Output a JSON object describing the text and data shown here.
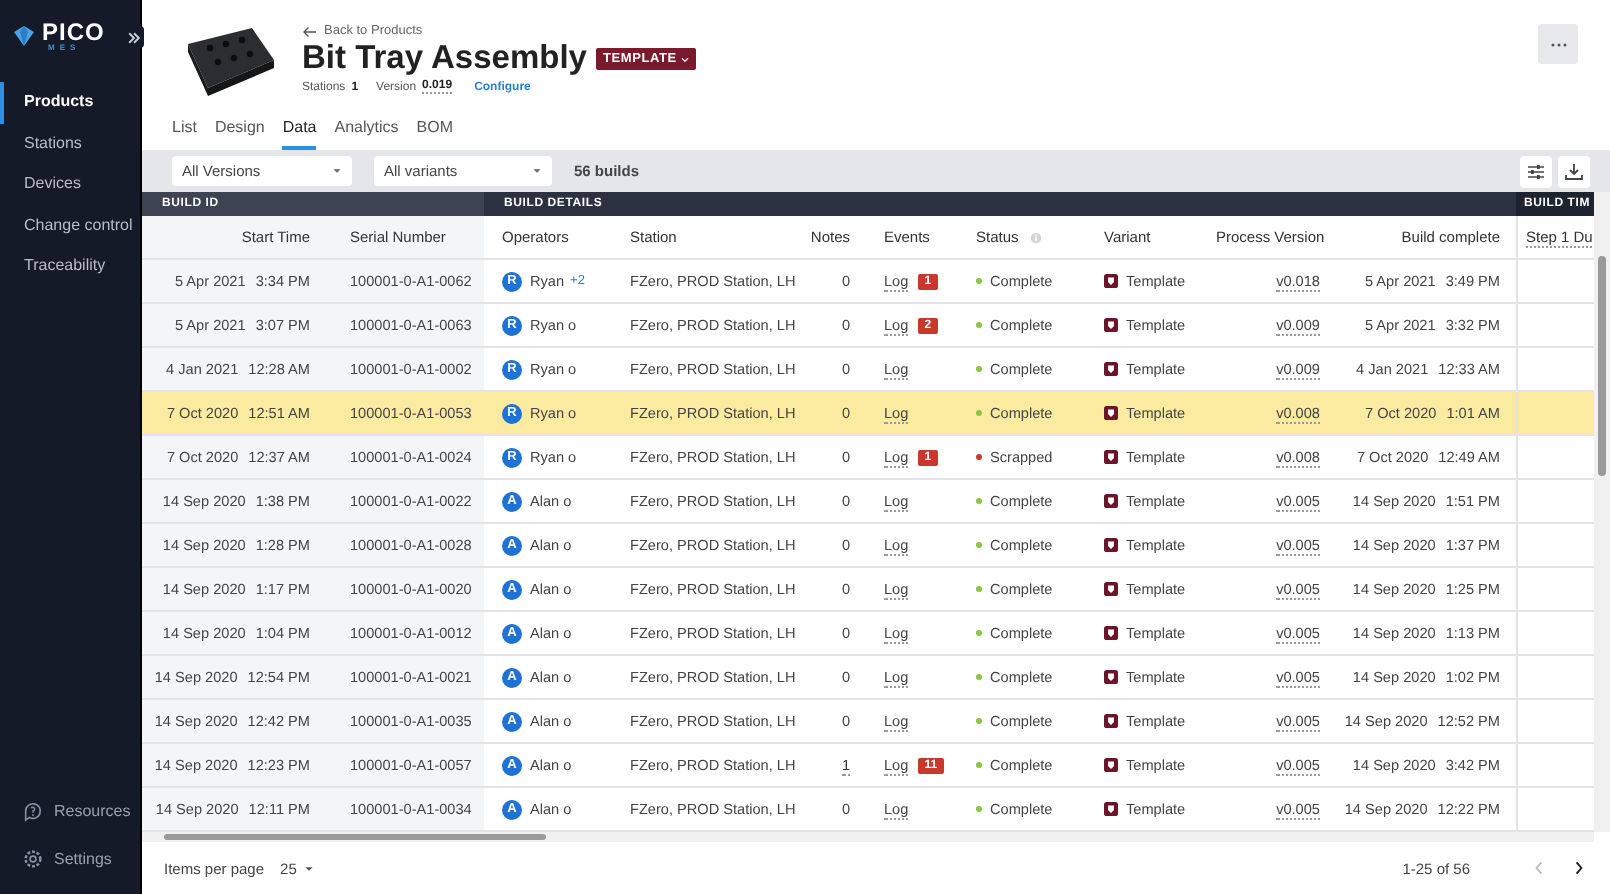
{
  "sidebar": {
    "logo": {
      "name": "PICO",
      "tagline": "MES"
    },
    "items": [
      {
        "label": "Products",
        "selected": true
      },
      {
        "label": "Stations",
        "selected": false
      },
      {
        "label": "Devices",
        "selected": false
      },
      {
        "label": "Change control",
        "selected": false
      },
      {
        "label": "Traceability",
        "selected": false
      }
    ],
    "footer_items": [
      {
        "label": "Resources",
        "kind": "help"
      },
      {
        "label": "Settings",
        "kind": "settings"
      }
    ]
  },
  "product": {
    "back_link": "Back to Products",
    "title": "Bit Tray Assembly",
    "badge": "TEMPLATE",
    "stations_label": "Stations",
    "stations_value": "1",
    "version_label": "Version",
    "version_value": "0.019",
    "configure_link": "Configure"
  },
  "tabs": [
    {
      "label": "List",
      "selected": false
    },
    {
      "label": "Design",
      "selected": false
    },
    {
      "label": "Data",
      "selected": true
    },
    {
      "label": "Analytics",
      "selected": false
    },
    {
      "label": "BOM",
      "selected": false
    }
  ],
  "filters": {
    "versions": "All Versions",
    "variants": "All variants",
    "count": "56 builds"
  },
  "table": {
    "groups": [
      {
        "label": "BUILD ID"
      },
      {
        "label": "BUILD DETAILS"
      },
      {
        "label": "BUILD TIM"
      }
    ],
    "columns": [
      {
        "label": "Start Time",
        "kind": "plain"
      },
      {
        "label": "Serial Number",
        "kind": "plain"
      },
      {
        "label": "Operators",
        "kind": "plain"
      },
      {
        "label": "Station",
        "kind": "plain"
      },
      {
        "label": "Notes",
        "kind": "plain"
      },
      {
        "label": "Events",
        "kind": "plain"
      },
      {
        "label": "Status",
        "kind": "info"
      },
      {
        "label": "Variant",
        "kind": "plain"
      },
      {
        "label": "Process Version",
        "kind": "plain"
      },
      {
        "label": "Build complete",
        "kind": "plain"
      },
      {
        "label": "Step 1 Du",
        "kind": "plain"
      }
    ],
    "rows": [
      {
        "selected": false,
        "start_date": "5 Apr 2021",
        "start_time": "3:34 PM",
        "serial": "100001-0-A1-0062",
        "initial": "R",
        "operator": "Ryan",
        "operator_extra": "+2",
        "station": "FZero, PROD Station, LH",
        "notes": "0",
        "notes_link": false,
        "events": "Log",
        "events_count": "1",
        "status": {
          "label": "Complete",
          "kind": "complete"
        },
        "variant": "Template",
        "version": "v0.018",
        "done_date": "5 Apr 2021",
        "done_time": "3:49 PM"
      },
      {
        "selected": false,
        "start_date": "5 Apr 2021",
        "start_time": "3:07 PM",
        "serial": "100001-0-A1-0063",
        "initial": "R",
        "operator": "Ryan o",
        "station": "FZero, PROD Station, LH",
        "notes": "0",
        "notes_link": false,
        "events": "Log",
        "events_count": "2",
        "status": {
          "label": "Complete",
          "kind": "complete"
        },
        "variant": "Template",
        "version": "v0.009",
        "done_date": "5 Apr 2021",
        "done_time": "3:32 PM"
      },
      {
        "selected": false,
        "start_date": "4 Jan 2021",
        "start_time": "12:28 AM",
        "serial": "100001-0-A1-0002",
        "initial": "R",
        "operator": "Ryan o",
        "station": "FZero, PROD Station, LH",
        "notes": "0",
        "notes_link": false,
        "events": "Log",
        "status": {
          "label": "Complete",
          "kind": "complete"
        },
        "variant": "Template",
        "version": "v0.009",
        "done_date": "4 Jan 2021",
        "done_time": "12:33 AM"
      },
      {
        "selected": true,
        "start_date": "7 Oct 2020",
        "start_time": "12:51 AM",
        "serial": "100001-0-A1-0053",
        "initial": "R",
        "operator": "Ryan o",
        "station": "FZero, PROD Station, LH",
        "notes": "0",
        "notes_link": false,
        "events": "Log",
        "status": {
          "label": "Complete",
          "kind": "complete"
        },
        "variant": "Template",
        "version": "v0.008",
        "done_date": "7 Oct 2020",
        "done_time": "1:01 AM"
      },
      {
        "selected": false,
        "start_date": "7 Oct 2020",
        "start_time": "12:37 AM",
        "serial": "100001-0-A1-0024",
        "initial": "R",
        "operator": "Ryan o",
        "station": "FZero, PROD Station, LH",
        "notes": "0",
        "notes_link": false,
        "events": "Log",
        "events_count": "1",
        "status": {
          "label": "Scrapped",
          "kind": "scrapped"
        },
        "variant": "Template",
        "version": "v0.008",
        "done_date": "7 Oct 2020",
        "done_time": "12:49 AM"
      },
      {
        "selected": false,
        "start_date": "14 Sep 2020",
        "start_time": "1:38 PM",
        "serial": "100001-0-A1-0022",
        "initial": "A",
        "operator": "Alan o",
        "station": "FZero, PROD Station, LH",
        "notes": "0",
        "notes_link": false,
        "events": "Log",
        "status": {
          "label": "Complete",
          "kind": "complete"
        },
        "variant": "Template",
        "version": "v0.005",
        "done_date": "14 Sep 2020",
        "done_time": "1:51 PM"
      },
      {
        "selected": false,
        "start_date": "14 Sep 2020",
        "start_time": "1:28 PM",
        "serial": "100001-0-A1-0028",
        "initial": "A",
        "operator": "Alan o",
        "station": "FZero, PROD Station, LH",
        "notes": "0",
        "notes_link": false,
        "events": "Log",
        "status": {
          "label": "Complete",
          "kind": "complete"
        },
        "variant": "Template",
        "version": "v0.005",
        "done_date": "14 Sep 2020",
        "done_time": "1:37 PM"
      },
      {
        "selected": false,
        "start_date": "14 Sep 2020",
        "start_time": "1:17 PM",
        "serial": "100001-0-A1-0020",
        "initial": "A",
        "operator": "Alan o",
        "station": "FZero, PROD Station, LH",
        "notes": "0",
        "notes_link": false,
        "events": "Log",
        "status": {
          "label": "Complete",
          "kind": "complete"
        },
        "variant": "Template",
        "version": "v0.005",
        "done_date": "14 Sep 2020",
        "done_time": "1:25 PM"
      },
      {
        "selected": false,
        "start_date": "14 Sep 2020",
        "start_time": "1:04 PM",
        "serial": "100001-0-A1-0012",
        "initial": "A",
        "operator": "Alan o",
        "station": "FZero, PROD Station, LH",
        "notes": "0",
        "notes_link": false,
        "events": "Log",
        "status": {
          "label": "Complete",
          "kind": "complete"
        },
        "variant": "Template",
        "version": "v0.005",
        "done_date": "14 Sep 2020",
        "done_time": "1:13 PM"
      },
      {
        "selected": false,
        "start_date": "14 Sep 2020",
        "start_time": "12:54 PM",
        "serial": "100001-0-A1-0021",
        "initial": "A",
        "operator": "Alan o",
        "station": "FZero, PROD Station, LH",
        "notes": "0",
        "notes_link": false,
        "events": "Log",
        "status": {
          "label": "Complete",
          "kind": "complete"
        },
        "variant": "Template",
        "version": "v0.005",
        "done_date": "14 Sep 2020",
        "done_time": "1:02 PM"
      },
      {
        "selected": false,
        "start_date": "14 Sep 2020",
        "start_time": "12:42 PM",
        "serial": "100001-0-A1-0035",
        "initial": "A",
        "operator": "Alan o",
        "station": "FZero, PROD Station, LH",
        "notes": "0",
        "notes_link": false,
        "events": "Log",
        "status": {
          "label": "Complete",
          "kind": "complete"
        },
        "variant": "Template",
        "version": "v0.005",
        "done_date": "14 Sep 2020",
        "done_time": "12:52 PM"
      },
      {
        "selected": false,
        "start_date": "14 Sep 2020",
        "start_time": "12:23 PM",
        "serial": "100001-0-A1-0057",
        "initial": "A",
        "operator": "Alan o",
        "station": "FZero, PROD Station, LH",
        "notes": "1",
        "notes_link": true,
        "events": "Log",
        "events_count": "11",
        "status": {
          "label": "Complete",
          "kind": "complete"
        },
        "variant": "Template",
        "version": "v0.005",
        "done_date": "14 Sep 2020",
        "done_time": "3:42 PM"
      },
      {
        "selected": false,
        "start_date": "14 Sep 2020",
        "start_time": "12:11 PM",
        "serial": "100001-0-A1-0034",
        "initial": "A",
        "operator": "Alan o",
        "station": "FZero, PROD Station, LH",
        "notes": "0",
        "notes_link": false,
        "events": "Log",
        "status": {
          "label": "Complete",
          "kind": "complete"
        },
        "variant": "Template",
        "version": "v0.005",
        "done_date": "14 Sep 2020",
        "done_time": "12:22 PM"
      }
    ]
  },
  "pagination": {
    "items_per_page_label": "Items per page",
    "items_per_page": "25",
    "range": "1-25 of 56",
    "prev_disabled": true
  }
}
